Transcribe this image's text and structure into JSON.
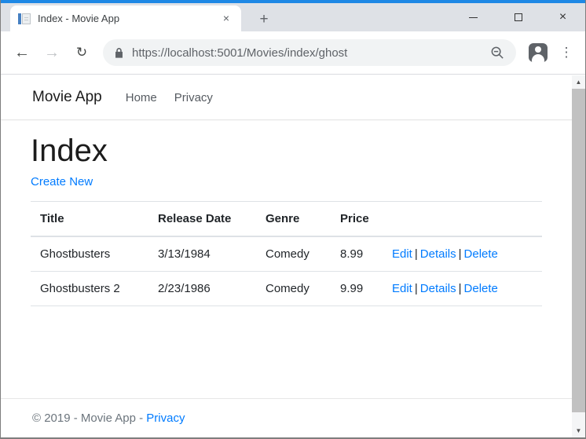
{
  "theme": {
    "accent-strip": "#1E88E5",
    "tabstrip-bg": "#DEE1E6",
    "toolbar-bg": "#FFFFFF",
    "omnibox-bg": "#F1F3F4",
    "url-color": "#5F6368",
    "link-color": "#007BFF",
    "text-color": "#212529",
    "muted-color": "#6C757D",
    "border-color": "#DEE2E6",
    "scroll-thumb": "#C1C1C1"
  },
  "browser": {
    "tab": {
      "title": "Index - Movie App",
      "close_glyph": "×"
    },
    "newtab_glyph": "+",
    "window_controls": {
      "close_glyph": "×"
    },
    "toolbar": {
      "back_glyph": "←",
      "forward_glyph": "→",
      "reload_glyph": "↻",
      "url": "https://localhost:5001/Movies/index/ghost",
      "kebab_glyph": "⋮"
    },
    "scrollbar": {
      "up_glyph": "▲",
      "down_glyph": "▼"
    }
  },
  "navbar": {
    "brand": "Movie App",
    "links": [
      {
        "label": "Home"
      },
      {
        "label": "Privacy"
      }
    ]
  },
  "page": {
    "heading": "Index",
    "create_link": "Create New"
  },
  "table": {
    "headers": [
      "Title",
      "Release Date",
      "Genre",
      "Price",
      ""
    ],
    "action_separator": "|",
    "rows": [
      {
        "title": "Ghostbusters",
        "release_date": "3/13/1984",
        "genre": "Comedy",
        "price": "8.99",
        "actions": [
          "Edit",
          "Details",
          "Delete"
        ]
      },
      {
        "title": "Ghostbusters 2",
        "release_date": "2/23/1986",
        "genre": "Comedy",
        "price": "9.99",
        "actions": [
          "Edit",
          "Details",
          "Delete"
        ]
      }
    ]
  },
  "footer": {
    "copyright": "© 2019 - Movie App -",
    "privacy_link": "Privacy"
  }
}
